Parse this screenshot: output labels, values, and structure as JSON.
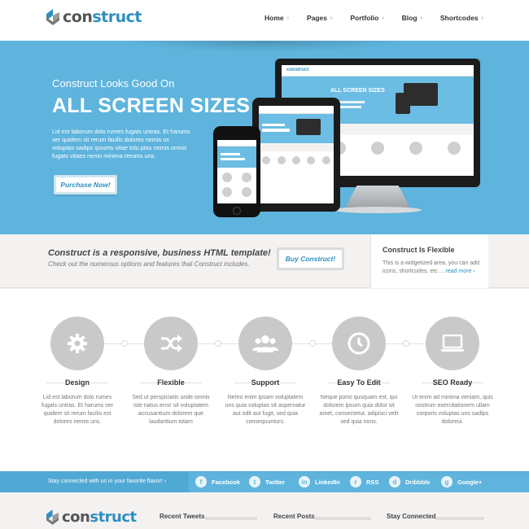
{
  "header": {
    "logo": {
      "part1": "con",
      "part2": "struct"
    },
    "nav": [
      {
        "label": "Home"
      },
      {
        "label": "Pages"
      },
      {
        "label": "Portfolio"
      },
      {
        "label": "Blog"
      },
      {
        "label": "Shortcodes"
      }
    ]
  },
  "hero": {
    "subtitle": "Construct Looks Good On",
    "title": "ALL SCREEN SIZES",
    "text": "Lid est laborum dolo rumes fugats untras. Et harums ser quidem sit rerum facilis dolores nemis us voluptas sadips ipsums vitae tolu ptas nemis omnis fugats vitaes nemo minima rerums uns.",
    "button": "Purchase Now!",
    "screen_logo": "construct",
    "screen_title": "ALL SCREEN SIZES"
  },
  "cta": {
    "title": "Construct is a responsive, business HTML template!",
    "subtitle": "Check out the numerous options and features that Construct includes.",
    "button": "Buy Construct!"
  },
  "widget": {
    "title": "Construct Is Flexible",
    "text": "This is a widgetized area, you can add icons, shortcodes, etc ... ",
    "link": "read more",
    "link_arrow": "›"
  },
  "features": [
    {
      "icon": "gear-icon",
      "title": "Design",
      "text": "Lid est laborum dolo rumes fugats untras. Et harums ser quidem sit rerum facilis est dolores nemis uns."
    },
    {
      "icon": "shuffle-icon",
      "title": "Flexible",
      "text": "Sed ut perspiciatis unde omnis iste natus error sit voluptatem accusantium dolorem que laudantium totam"
    },
    {
      "icon": "users-icon",
      "title": "Support",
      "text": "Nemo enim ipsam voluptatem uns quia voluptas sit aspernatur aut odit aut fugit, sed quia consequunturs."
    },
    {
      "icon": "clock-icon",
      "title": "Easy To Edit",
      "text": "Neque porro qusquam est, qui dolorem ipsum quia dolor sit amet, consectetur, adipisci velit sed quia nons."
    },
    {
      "icon": "laptop-icon",
      "title": "SEO Ready",
      "text": "Ut enim ad minima veniam, quis nostrum exercitationem ullam corporis voluptas uns sadips doloreui."
    }
  ],
  "social": {
    "text": "Stay connected with us in your favorite flavor!",
    "arrow": "›",
    "items": [
      {
        "label": "Facebook",
        "glyph": "f"
      },
      {
        "label": "Twitter",
        "glyph": "t"
      },
      {
        "label": "LinkedIn",
        "glyph": "in"
      },
      {
        "label": "RSS",
        "glyph": "r"
      },
      {
        "label": "Dribbble",
        "glyph": "d"
      },
      {
        "label": "Google+",
        "glyph": "g"
      }
    ]
  },
  "footer": {
    "logo": {
      "part1": "con",
      "part2": "struct"
    },
    "columns": [
      {
        "title": "Recent Tweets"
      },
      {
        "title": "Recent Posts"
      },
      {
        "title": "Stay Connected"
      }
    ]
  },
  "colors": {
    "accent": "#5eb4dd",
    "link": "#2f8fbf",
    "icon_circle": "#c9c9c9"
  }
}
